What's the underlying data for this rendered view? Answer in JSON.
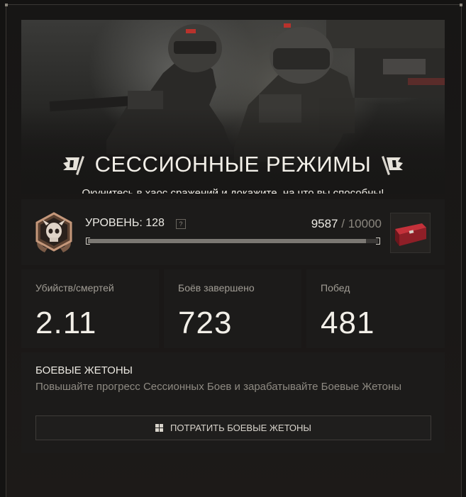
{
  "banner": {
    "title": "СЕССИОННЫЕ РЕЖИМЫ",
    "subtitle": "Окунитесь в хаос сражений и докажите, на что вы способны!",
    "left_icon": "flag-icon",
    "right_icon": "flag-icon"
  },
  "level": {
    "label": "УРОВЕНЬ: 128",
    "help_glyph": "?",
    "xp_current": "9587",
    "xp_separator": "/",
    "xp_max": "10000",
    "progress": 0.9587,
    "badge_icon": "rank-skull-badge-icon",
    "reward_icon": "reward-crate-icon"
  },
  "stats": [
    {
      "label": "Убийств/смертей",
      "value": "2.11"
    },
    {
      "label": "Боёв завершено",
      "value": "723"
    },
    {
      "label": "Побед",
      "value": "481"
    }
  ],
  "tokens": {
    "title": "БОЕВЫЕ ЖЕТОНЫ",
    "description": "Повышайте прогресс Сессионных Боев и зарабатывайте Боевые Жетоны",
    "button_label": "ПОТРАТИТЬ БОЕВЫЕ ЖЕТОНЫ",
    "button_icon": "grid-icon"
  },
  "colors": {
    "background": "#141312",
    "panel": "#1c1b1a",
    "text": "#f2efe8",
    "muted": "#8e8a82",
    "badge_bronze": "#b98a6e",
    "crate_red": "#a3212a"
  }
}
